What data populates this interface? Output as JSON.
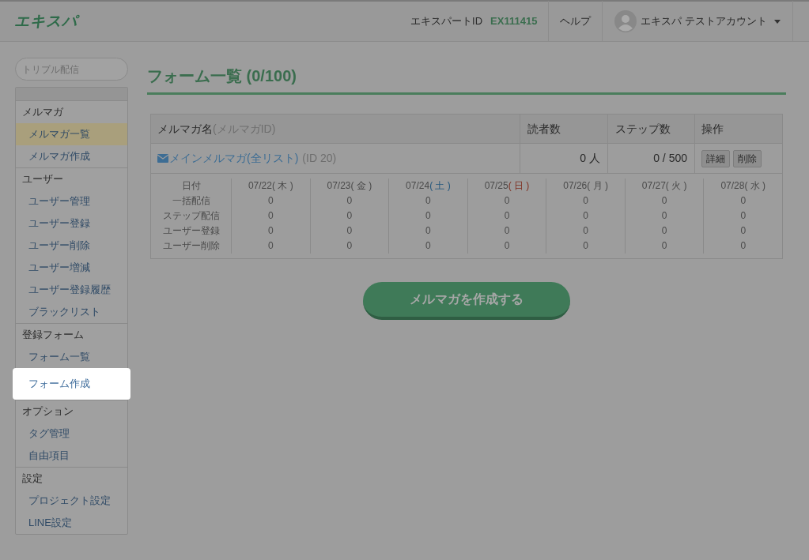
{
  "header": {
    "logo": "エキスパ",
    "id_label": "エキスパートID",
    "id_value": "EX111415",
    "help": "ヘルプ",
    "account": "エキスパ テストアカウント"
  },
  "sidebar": {
    "search": {
      "placeholder": "トリプル配信"
    },
    "groups": [
      {
        "heading": "メルマガ",
        "items": [
          {
            "label": "メルマガ一覧",
            "selected": true,
            "highlighted": false
          },
          {
            "label": "メルマガ作成",
            "selected": false,
            "highlighted": false
          }
        ]
      },
      {
        "heading": "ユーザー",
        "items": [
          {
            "label": "ユーザー管理",
            "selected": false,
            "highlighted": false
          },
          {
            "label": "ユーザー登録",
            "selected": false,
            "highlighted": false
          },
          {
            "label": "ユーザー削除",
            "selected": false,
            "highlighted": false
          },
          {
            "label": "ユーザー増減",
            "selected": false,
            "highlighted": false
          },
          {
            "label": "ユーザー登録履歴",
            "selected": false,
            "highlighted": false
          },
          {
            "label": "ブラックリスト",
            "selected": false,
            "highlighted": false
          }
        ]
      },
      {
        "heading": "登録フォーム",
        "items": [
          {
            "label": "フォーム一覧",
            "selected": false,
            "highlighted": false
          },
          {
            "label": "フォーム作成",
            "selected": false,
            "highlighted": true
          }
        ]
      },
      {
        "heading": "オプション",
        "items": [
          {
            "label": "タグ管理",
            "selected": false,
            "highlighted": false
          },
          {
            "label": "自由項目",
            "selected": false,
            "highlighted": false
          }
        ]
      },
      {
        "heading": "設定",
        "items": [
          {
            "label": "プロジェクト設定",
            "selected": false,
            "highlighted": false
          },
          {
            "label": "LINE設定",
            "selected": false,
            "highlighted": false
          }
        ]
      }
    ]
  },
  "page_title": "フォーム一覧 (0/100)",
  "table": {
    "columns": {
      "name": "メルマガ名",
      "name_sub": "(メルマガID)",
      "readers": "読者数",
      "steps": "ステップ数",
      "actions": "操作"
    },
    "rows": [
      {
        "name": "メインメルマガ(全リスト)",
        "id": "(ID 20)",
        "readers": "0 人",
        "steps": "0 / 500",
        "buttons": [
          "詳細",
          "削除"
        ],
        "stats": {
          "labels": [
            "日付",
            "一括配信",
            "ステップ配信",
            "ユーザー登録",
            "ユーザー削除"
          ],
          "days": [
            {
              "date": "07/22",
              "weekday": "( 木 )",
              "color": "#4a4a4a",
              "values": [
                "0",
                "0",
                "0",
                "0"
              ]
            },
            {
              "date": "07/23",
              "weekday": "( 金 )",
              "color": "#4a4a4a",
              "values": [
                "0",
                "0",
                "0",
                "0"
              ]
            },
            {
              "date": "07/24",
              "weekday": "( 土 )",
              "color": "#24577d",
              "values": [
                "0",
                "0",
                "0",
                "0"
              ]
            },
            {
              "date": "07/25",
              "weekday": "( 日 )",
              "color": "#7f2f20",
              "values": [
                "0",
                "0",
                "0",
                "0"
              ]
            },
            {
              "date": "07/26",
              "weekday": "( 月 )",
              "color": "#4a4a4a",
              "values": [
                "0",
                "0",
                "0",
                "0"
              ]
            },
            {
              "date": "07/27",
              "weekday": "( 火 )",
              "color": "#4a4a4a",
              "values": [
                "0",
                "0",
                "0",
                "0"
              ]
            },
            {
              "date": "07/28",
              "weekday": "( 水 )",
              "color": "#4a4a4a",
              "values": [
                "0",
                "0",
                "0",
                "0"
              ]
            }
          ]
        }
      }
    ]
  },
  "create_button": "メルマガを作成する"
}
